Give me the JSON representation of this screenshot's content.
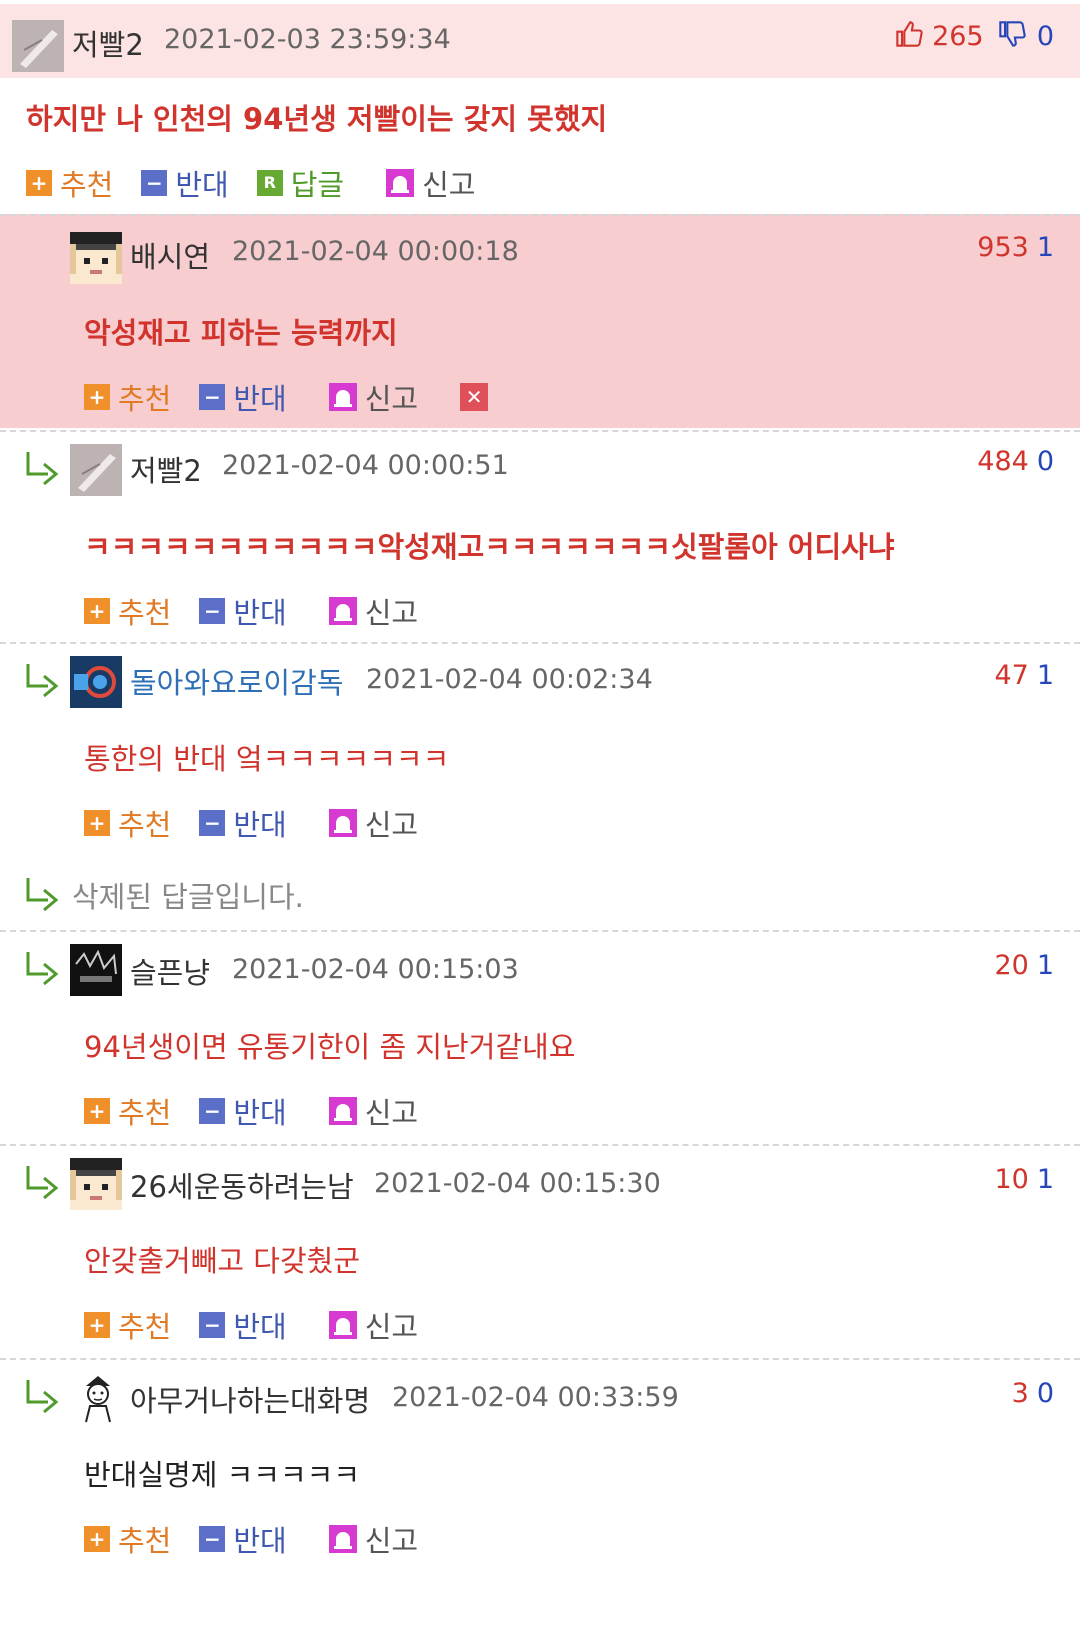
{
  "comments": [
    {
      "nick": "저빨2",
      "date": "2021-02-03 23:59:34",
      "up": "265",
      "down": "0",
      "body": "하지만 나 인천의 94년생 저빨이는 갖지 못했지",
      "actions": {
        "recommend": "추천",
        "oppose": "반대",
        "reply": "답글",
        "report": "신고"
      }
    },
    {
      "nick": "배시연",
      "date": "2021-02-04 00:00:18",
      "up": "953",
      "down": "1",
      "body": "악성재고 피하는 능력까지",
      "actions": {
        "recommend": "추천",
        "oppose": "반대",
        "report": "신고"
      }
    },
    {
      "nick": "저빨2",
      "date": "2021-02-04 00:00:51",
      "up": "484",
      "down": "0",
      "body": "ㅋㅋㅋㅋㅋㅋㅋㅋㅋㅋㅋ악성재고ㅋㅋㅋㅋㅋㅋㅋ싯팔롬아 어디사냐",
      "actions": {
        "recommend": "추천",
        "oppose": "반대",
        "report": "신고"
      }
    },
    {
      "nick": "돌아와요로이감독",
      "date": "2021-02-04 00:02:34",
      "up": "47",
      "down": "1",
      "body": "통한의 반대 엌ㅋㅋㅋㅋㅋㅋㅋ",
      "actions": {
        "recommend": "추천",
        "oppose": "반대",
        "report": "신고"
      }
    },
    {
      "deleted_text": "삭제된 답글입니다."
    },
    {
      "nick": "슬픈냥",
      "date": "2021-02-04 00:15:03",
      "up": "20",
      "down": "1",
      "body": "94년생이면 유통기한이 좀 지난거같내요",
      "actions": {
        "recommend": "추천",
        "oppose": "반대",
        "report": "신고"
      }
    },
    {
      "nick": "26세운동하려는남",
      "date": "2021-02-04 00:15:30",
      "up": "10",
      "down": "1",
      "body": "안갖출거빼고 다갖췄군",
      "actions": {
        "recommend": "추천",
        "oppose": "반대",
        "report": "신고"
      }
    },
    {
      "nick": "아무거나하는대화명",
      "date": "2021-02-04 00:33:59",
      "up": "3",
      "down": "0",
      "body": "반대실명제 ㅋㅋㅋㅋㅋ",
      "actions": {
        "recommend": "추천",
        "oppose": "반대",
        "report": "신고"
      }
    }
  ],
  "icons": {
    "thumb_up": "thumb-up-icon",
    "thumb_down": "thumb-down-icon",
    "reply_arrow": "reply-arrow-icon",
    "delete": "delete-icon"
  },
  "colors": {
    "top_bg": "#fde4e4",
    "highlight_bg": "#f7cdcf",
    "up": "#d0342c",
    "down": "#2546b8"
  }
}
